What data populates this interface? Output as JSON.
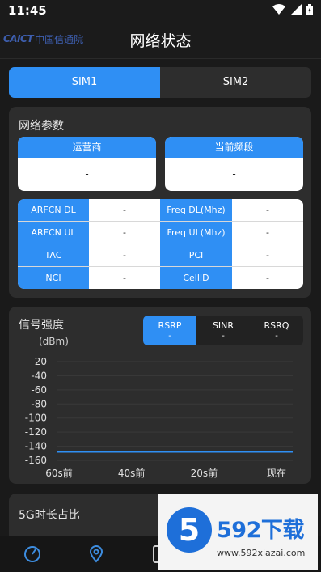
{
  "status_bar": {
    "time": "11:45",
    "icons": [
      "wifi-icon",
      "signal-icon",
      "battery-icon"
    ]
  },
  "header": {
    "logo_en": "CAICT",
    "logo_cn": "中国信通院",
    "title": "网络状态"
  },
  "sim_tabs": [
    {
      "label": "SIM1",
      "active": true
    },
    {
      "label": "SIM2",
      "active": false
    }
  ],
  "network_params": {
    "title": "网络参数",
    "operator": {
      "label": "运营商",
      "value": "-"
    },
    "band": {
      "label": "当前频段",
      "value": "-"
    },
    "rows": [
      {
        "k1": "ARFCN DL",
        "v1": "-",
        "k2": "Freq DL(Mhz)",
        "v2": "-"
      },
      {
        "k1": "ARFCN UL",
        "v1": "-",
        "k2": "Freq UL(Mhz)",
        "v2": "-"
      },
      {
        "k1": "TAC",
        "v1": "-",
        "k2": "PCI",
        "v2": "-"
      },
      {
        "k1": "NCI",
        "v1": "-",
        "k2": "CellID",
        "v2": "-"
      }
    ]
  },
  "signal": {
    "title": "信号强度",
    "unit": "(dBm)",
    "metric_tabs": [
      {
        "label": "RSRP",
        "value": "-",
        "active": true
      },
      {
        "label": "SINR",
        "value": "-",
        "active": false
      },
      {
        "label": "RSRQ",
        "value": "-",
        "active": false
      }
    ]
  },
  "chart_data": {
    "type": "line",
    "title": "",
    "xlabel": "",
    "ylabel": "(dBm)",
    "x_ticks": [
      "60s前",
      "40s前",
      "20s前",
      "现在"
    ],
    "y_ticks": [
      -20,
      -40,
      -60,
      -80,
      -100,
      -120,
      -140,
      -160
    ],
    "ylim": [
      -160,
      -20
    ],
    "grid": true,
    "series": [
      {
        "color": "#2f8ff4",
        "x": [
          "60s前",
          "现在"
        ],
        "values": [
          -148,
          -148
        ]
      }
    ]
  },
  "section_5g": {
    "title": "5G时长占比"
  },
  "bottom_nav": [
    {
      "icon": "speedometer-icon"
    },
    {
      "icon": "map-pin-icon"
    },
    {
      "icon": "phone-icon"
    }
  ],
  "watermark": {
    "badge": "5",
    "brand": "592下载",
    "url": "www.592xiazai.com"
  },
  "colors": {
    "accent": "#2f8ff4",
    "background": "#1a1a1a",
    "card": "#2d2d2d"
  }
}
